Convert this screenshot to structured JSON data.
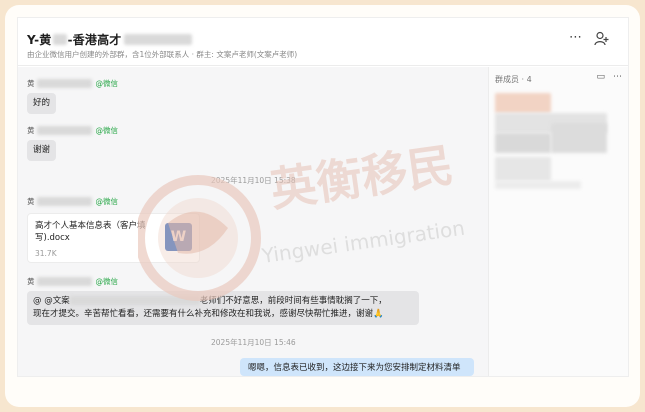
{
  "header": {
    "title_prefix": "Y-黄",
    "title_suffix": "-香港高才",
    "subtitle": "由企业微信用户创建的外部群，含1位外部联系人 · 群主: 文案卢老师(文案卢老师)",
    "more_icon": "ellipsis-icon",
    "add_member_icon": "add-user-icon"
  },
  "messages": [
    {
      "sender": "黄",
      "tag": "@微信",
      "text": "好的"
    },
    {
      "sender": "黄",
      "tag": "@微信",
      "text": "谢谢"
    },
    {
      "timestamp": "2025年11月10日 15:38"
    },
    {
      "sender": "黄",
      "tag": "@微信",
      "file": {
        "name": "高才个人基本信息表（客户填写).docx",
        "size": "31.7K",
        "icon_label": "W"
      }
    },
    {
      "sender": "黄",
      "tag": "@微信",
      "line1_prefix": "@ @文案",
      "line1_suffix": "老师们不好意思，前段时间有些事情耽搁了一下，",
      "line2": "现在才提交。辛苦帮忙看看，还需要有什么补充和修改在和我说，感谢尽快帮忙推进，谢谢🙏"
    },
    {
      "timestamp": "2025年11月10日 15:46"
    },
    {
      "outgoing": "嗯嗯，信息表已收到，这边接下来为您安排制定材料清单"
    }
  ],
  "members": {
    "title": "群成员 · 4"
  },
  "watermark": {
    "cn": "英衡移民",
    "en": "Yingwei immigration"
  }
}
